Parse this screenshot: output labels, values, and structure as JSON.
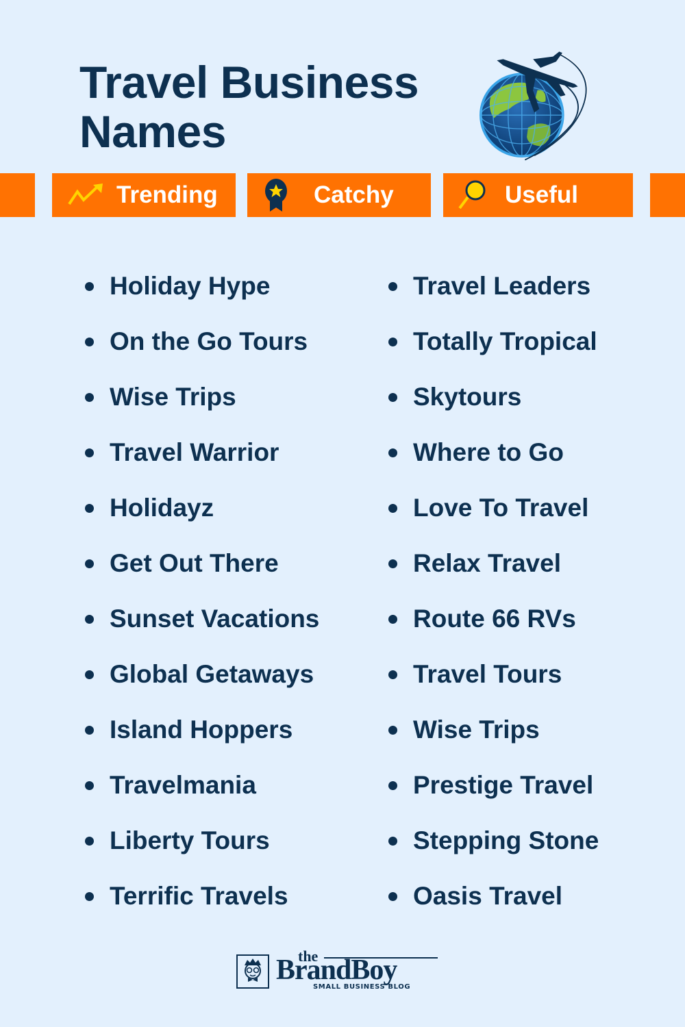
{
  "header": {
    "title_line1": "Travel Business",
    "title_line2": "Names",
    "illustration": "globe-with-airplane-icon"
  },
  "tags": [
    {
      "label": "Trending",
      "icon": "trending-up-arrow-icon"
    },
    {
      "label": "Catchy",
      "icon": "award-ribbon-star-icon"
    },
    {
      "label": "Useful",
      "icon": "magnifying-glass-icon"
    }
  ],
  "names": {
    "left": [
      "Holiday Hype",
      "On the Go Tours",
      "Wise Trips",
      "Travel Warrior",
      "Holidayz",
      "Get Out There",
      "Sunset Vacations",
      "Global Getaways",
      "Island Hoppers",
      "Travelmania",
      "Liberty Tours",
      "Terrific Travels"
    ],
    "right": [
      "Travel Leaders",
      "Totally Tropical",
      "Skytours",
      "Where to Go",
      "Love To Travel",
      "Relax Travel",
      "Route 66 RVs",
      "Travel Tours",
      "Wise Trips",
      "Prestige Travel",
      "Stepping Stone",
      "Oasis Travel"
    ]
  },
  "footer": {
    "logo_the": "the",
    "logo_brand": "BrandBoy",
    "logo_tagline": "SMALL BUSINESS BLOG"
  },
  "colors": {
    "background": "#e3f0fd",
    "text": "#0d3050",
    "accent": "#ff7202",
    "icon_yellow": "#ffd400"
  }
}
